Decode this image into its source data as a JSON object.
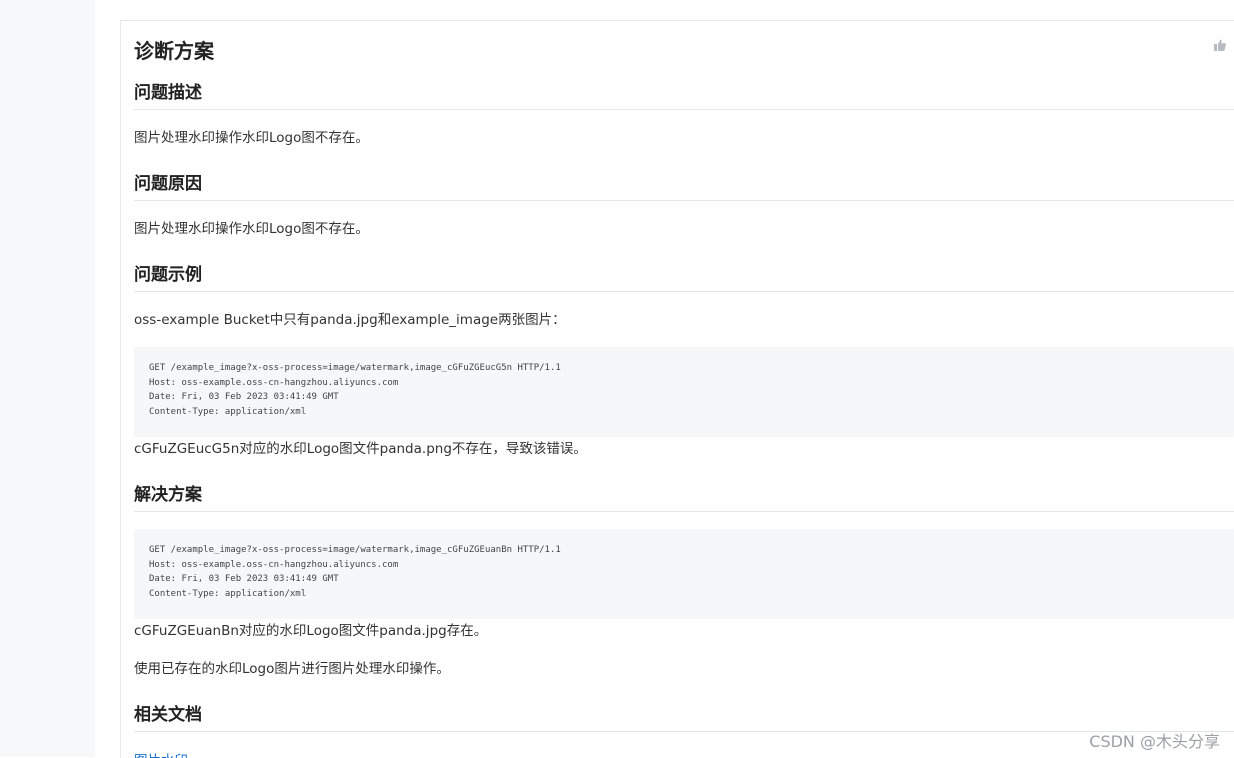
{
  "doc": {
    "title": "诊断方案",
    "sections": {
      "desc": {
        "heading": "问题描述",
        "text": "图片处理水印操作水印Logo图不存在。"
      },
      "cause": {
        "heading": "问题原因",
        "text": "图片处理水印操作水印Logo图不存在。"
      },
      "example": {
        "heading": "问题示例",
        "intro": "oss-example Bucket中只有panda.jpg和example_image两张图片：",
        "code": "GET /example_image?x-oss-process=image/watermark,image_cGFuZGEucG5n HTTP/1.1\nHost: oss-example.oss-cn-hangzhou.aliyuncs.com\nDate: Fri, 03 Feb 2023 03:41:49 GMT\nContent-Type: application/xml",
        "after": "cGFuZGEucG5n对应的水印Logo图文件panda.png不存在，导致该错误。"
      },
      "solution": {
        "heading": "解决方案",
        "code": "GET /example_image?x-oss-process=image/watermark,image_cGFuZGEuanBn HTTP/1.1\nHost: oss-example.oss-cn-hangzhou.aliyuncs.com\nDate: Fri, 03 Feb 2023 03:41:49 GMT\nContent-Type: application/xml",
        "after1": "cGFuZGEuanBn对应的水印Logo图文件panda.jpg存在。",
        "after2": "使用已存在的水印Logo图片进行图片处理水印操作。"
      },
      "related": {
        "heading": "相关文档",
        "link": "图片水印"
      }
    }
  },
  "watermark": "CSDN @木头分享",
  "icons": {
    "like": "thumbs-up-icon"
  }
}
